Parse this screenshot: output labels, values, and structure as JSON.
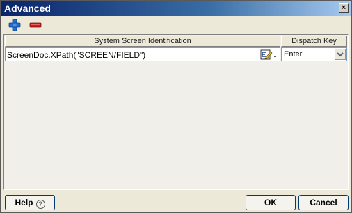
{
  "window": {
    "title": "Advanced",
    "close_symbol": "×"
  },
  "toolbar": {
    "add_icon": "plus-icon",
    "remove_icon": "minus-icon"
  },
  "grid": {
    "columns": [
      "System Screen Identification",
      "Dispatch Key"
    ],
    "rows": [
      {
        "identification": "ScreenDoc.XPath(\"SCREEN/FIELD\")",
        "dispatch_key": "Enter"
      }
    ]
  },
  "buttons": {
    "help": "Help",
    "help_symbol": "?",
    "ok": "OK",
    "cancel": "Cancel"
  },
  "colors": {
    "titlebar_start": "#0a246a",
    "titlebar_end": "#a6caf0",
    "add_blue": "#1f6fd1",
    "remove_red": "#cc1f1f"
  }
}
